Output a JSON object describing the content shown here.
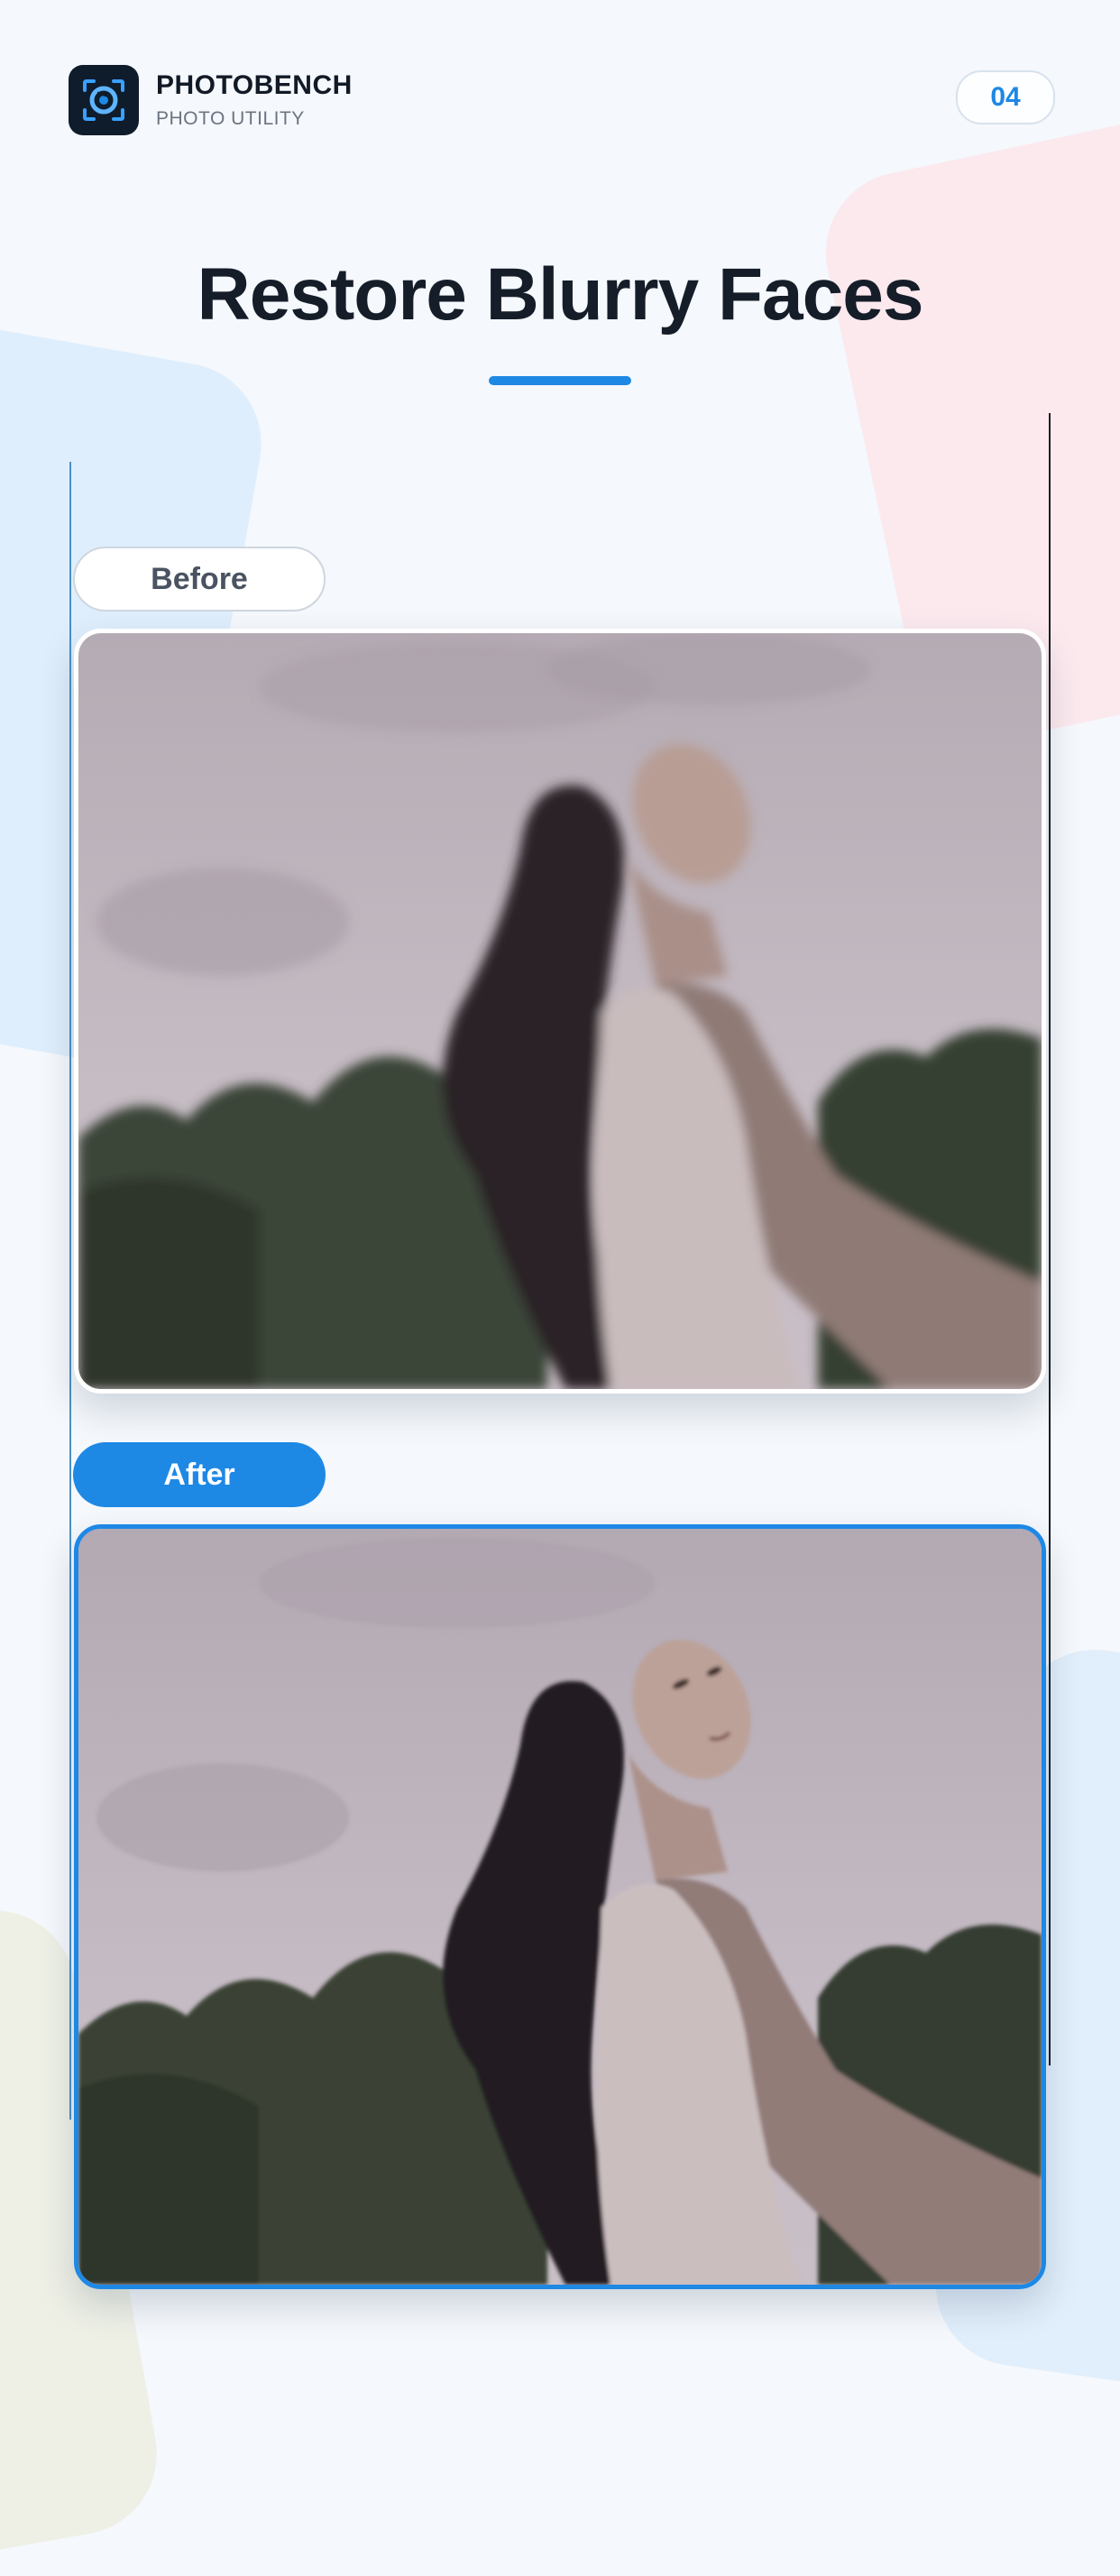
{
  "header": {
    "app_icon": "camera-lens-icon",
    "brand_name": "PHOTOBENCH",
    "brand_subtitle": "PHOTO UTILITY",
    "page_number": "04"
  },
  "main": {
    "title": "Restore Blurry Faces",
    "before_label": "Before",
    "after_label": "After"
  },
  "colors": {
    "accent": "#1e88e5",
    "title": "#151d29",
    "background": "#f5f8fc"
  }
}
